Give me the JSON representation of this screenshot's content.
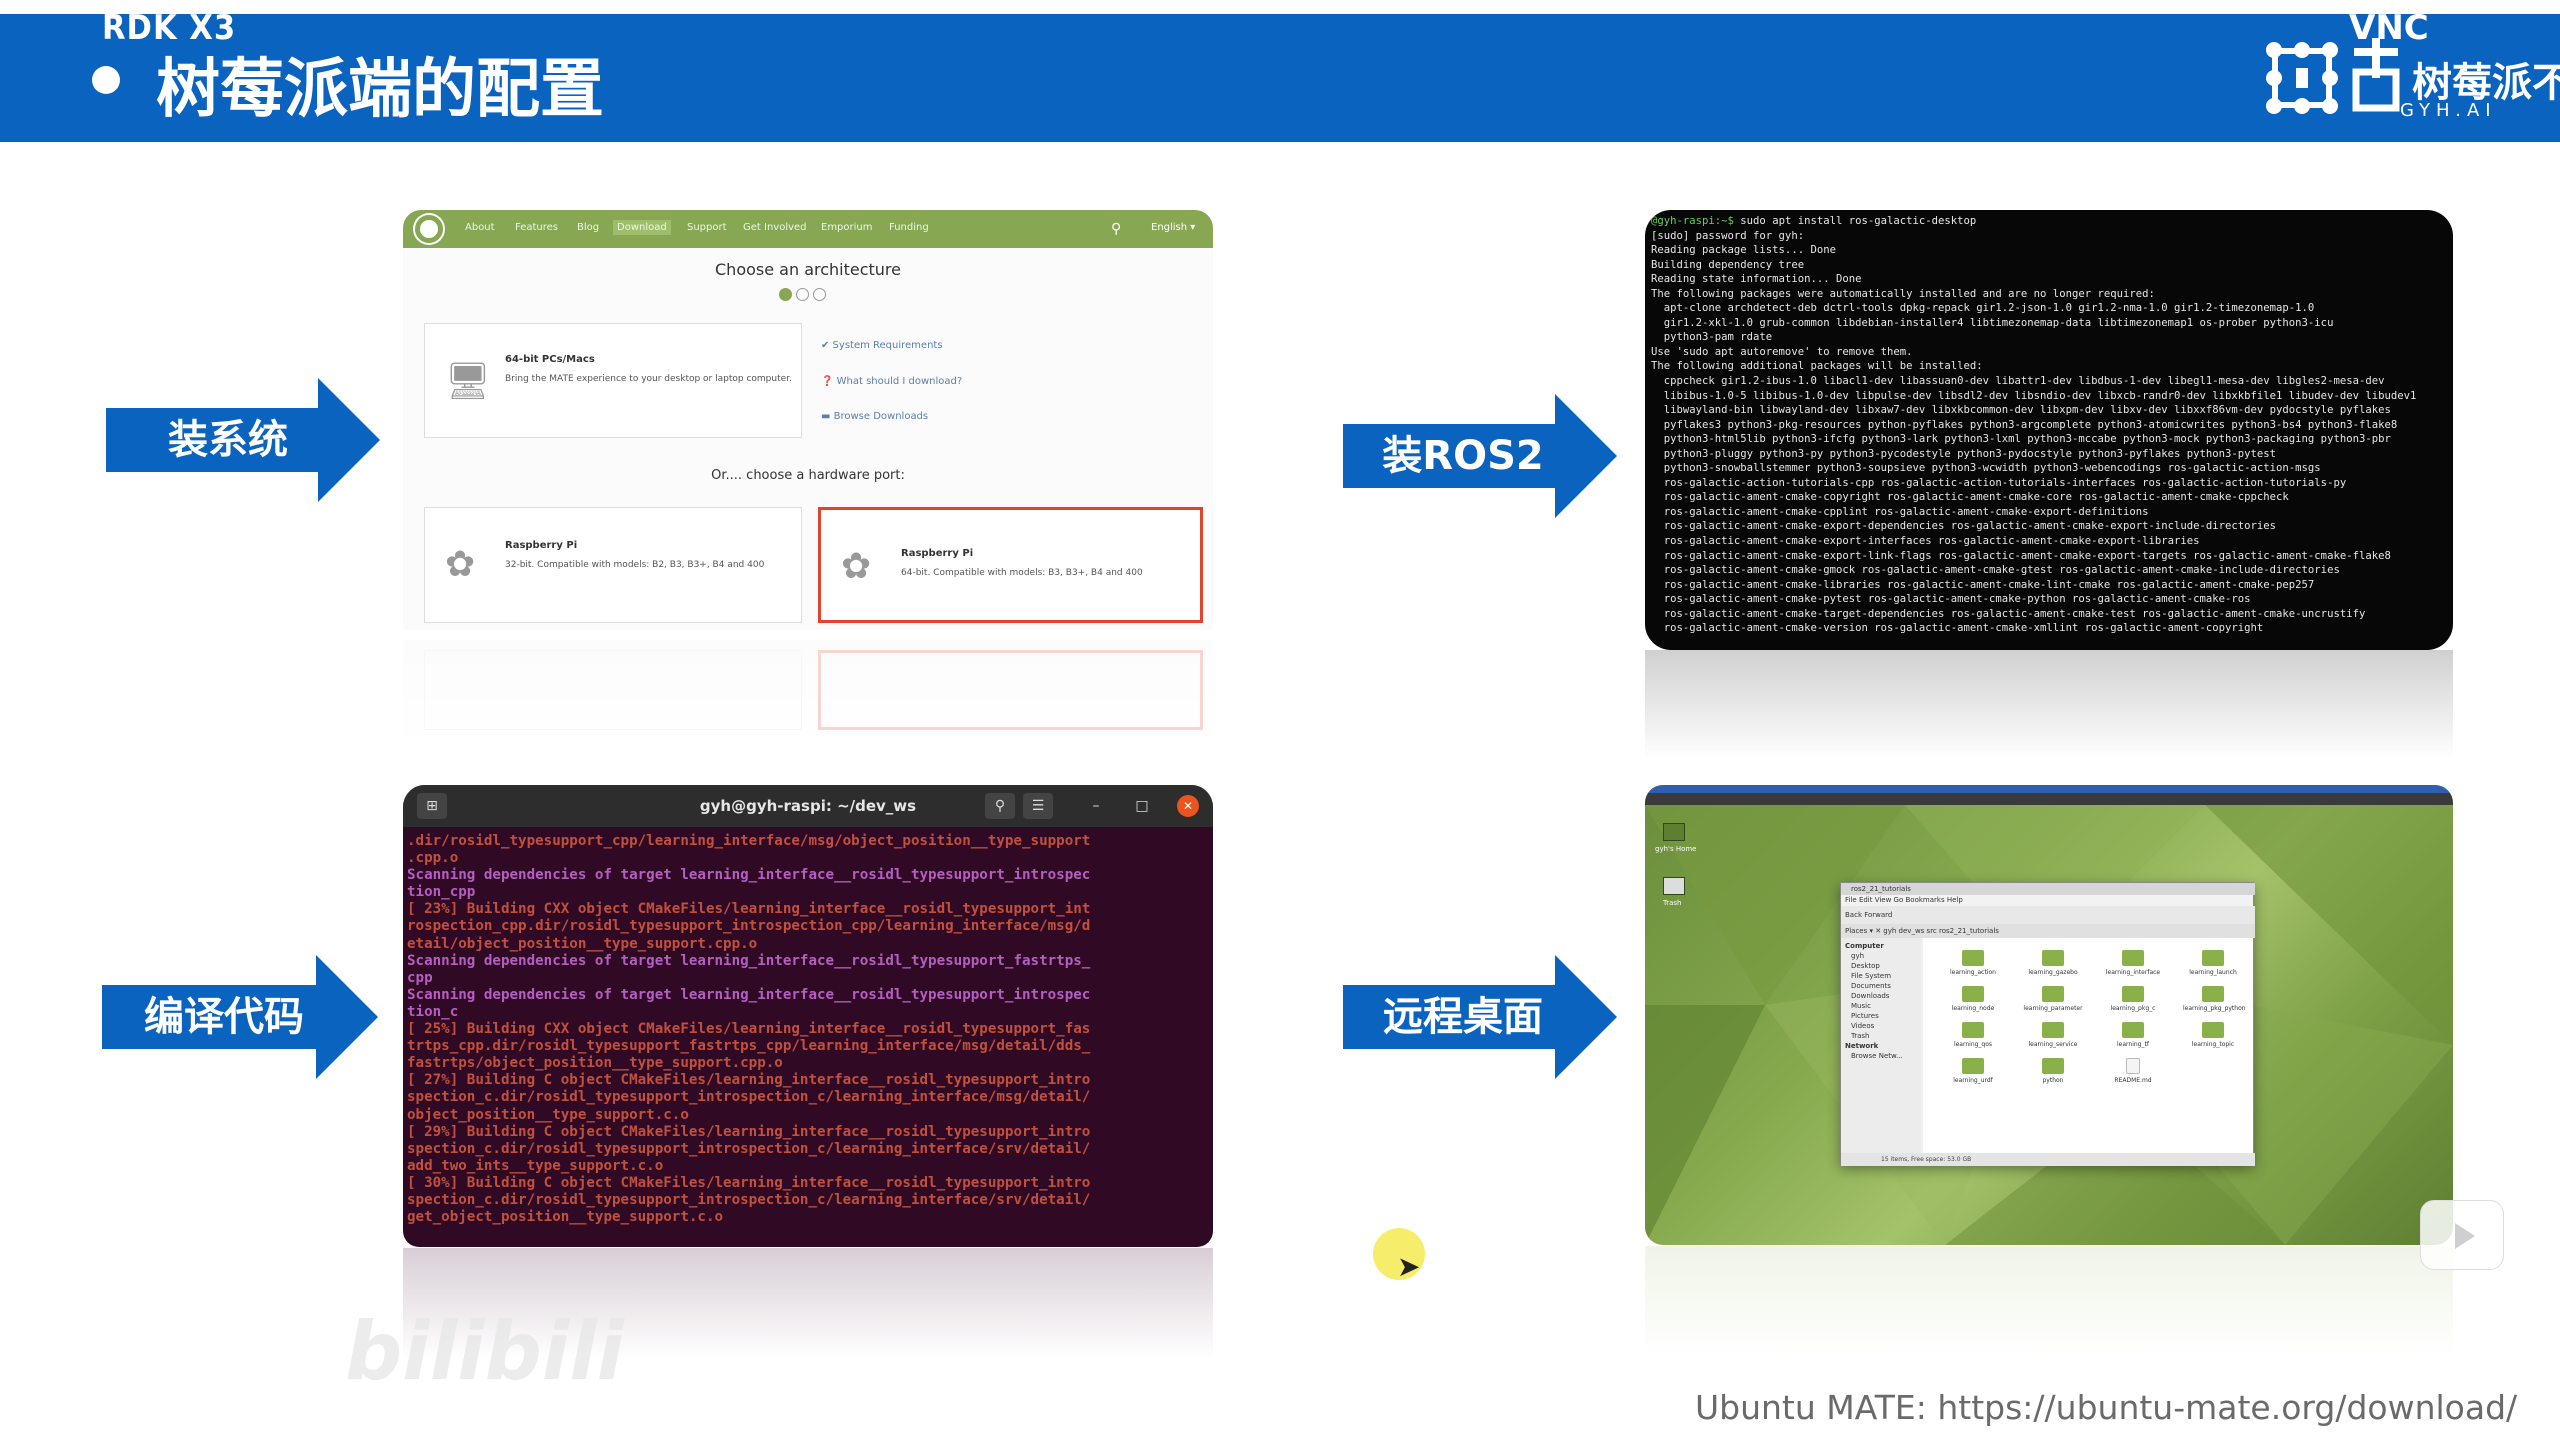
{
  "header": {
    "corner_left": "RDK  X3",
    "corner_right": "VNC",
    "title": "树莓派端的配置",
    "logo_text": "树莓派不",
    "logo_sub": "GYH.AI"
  },
  "arrows": {
    "install_system": "装系统",
    "install_ros2": "装ROS2",
    "compile_code": "编译代码",
    "remote_desktop": "远程桌面"
  },
  "mate_site": {
    "nav": [
      "About",
      "Features",
      "Blog",
      "Download",
      "Support",
      "Get Involved",
      "Emporium",
      "Funding"
    ],
    "lang": "English ▾",
    "heading": "Choose an architecture",
    "card_pc_title": "64-bit PCs/Macs",
    "card_pc_desc": "Bring the MATE experience to your desktop or laptop computer.",
    "link_sysreq": "✔ System Requirements",
    "link_which": "❓ What should I download?",
    "link_browse": "▬ Browse Downloads",
    "or_text": "Or.... choose a hardware port:",
    "card_pi32_title": "Raspberry Pi",
    "card_pi32_desc": "32-bit. Compatible with models: B2, B3, B3+, B4 and 400",
    "card_pi64_title": "Raspberry Pi",
    "card_pi64_desc": "64-bit. Compatible with models: B3, B3+, B4 and 400"
  },
  "ros_terminal": {
    "prompt": "@gyh-raspi:~$",
    "command": " sudo apt install ros-galactic-desktop",
    "lines": [
      "[sudo] password for gyh:",
      "Reading package lists... Done",
      "Building dependency tree",
      "Reading state information... Done",
      "The following packages were automatically installed and are no longer required:",
      "  apt-clone archdetect-deb dctrl-tools dpkg-repack gir1.2-json-1.0 gir1.2-nma-1.0 gir1.2-timezonemap-1.0",
      "  gir1.2-xkl-1.0 grub-common libdebian-installer4 libtimezonemap-data libtimezonemap1 os-prober python3-icu",
      "  python3-pam rdate",
      "Use 'sudo apt autoremove' to remove them.",
      "The following additional packages will be installed:",
      "  cppcheck gir1.2-ibus-1.0 libacl1-dev libassuan0-dev libattr1-dev libdbus-1-dev libegl1-mesa-dev libgles2-mesa-dev",
      "  libibus-1.0-5 libibus-1.0-dev libpulse-dev libsdl2-dev libsndio-dev libxcb-randr0-dev libxkbfile1 libudev-dev libudev1",
      "  libwayland-bin libwayland-dev libxaw7-dev libxkbcommon-dev libxpm-dev libxv-dev libxxf86vm-dev pydocstyle pyflakes",
      "  pyflakes3 python3-pkg-resources python-pyflakes python3-argcomplete python3-atomicwrites python3-bs4 python3-flake8",
      "  python3-html5lib python3-ifcfg python3-lark python3-lxml python3-mccabe python3-mock python3-packaging python3-pbr",
      "  python3-pluggy python3-py python3-pycodestyle python3-pydocstyle python3-pyflakes python3-pytest",
      "  python3-snowballstemmer python3-soupsieve python3-wcwidth python3-webencodings ros-galactic-action-msgs",
      "  ros-galactic-action-tutorials-cpp ros-galactic-action-tutorials-interfaces ros-galactic-action-tutorials-py",
      "  ros-galactic-ament-cmake-copyright ros-galactic-ament-cmake-core ros-galactic-ament-cmake-cppcheck",
      "  ros-galactic-ament-cmake-cpplint ros-galactic-ament-cmake-export-definitions",
      "  ros-galactic-ament-cmake-export-dependencies ros-galactic-ament-cmake-export-include-directories",
      "  ros-galactic-ament-cmake-export-interfaces ros-galactic-ament-cmake-export-libraries",
      "  ros-galactic-ament-cmake-export-link-flags ros-galactic-ament-cmake-export-targets ros-galactic-ament-cmake-flake8",
      "  ros-galactic-ament-cmake-gmock ros-galactic-ament-cmake-gtest ros-galactic-ament-cmake-include-directories",
      "  ros-galactic-ament-cmake-libraries ros-galactic-ament-cmake-lint-cmake ros-galactic-ament-cmake-pep257",
      "  ros-galactic-ament-cmake-pytest ros-galactic-ament-cmake-python ros-galactic-ament-cmake-ros",
      "  ros-galactic-ament-cmake-target-dependencies ros-galactic-ament-cmake-test ros-galactic-ament-cmake-uncrustify",
      "  ros-galactic-ament-cmake-version ros-galactic-ament-cmake-xmllint ros-galactic-ament-copyright"
    ]
  },
  "build_terminal": {
    "title": "gyh@gyh-raspi: ~/dev_ws",
    "lines": [
      {
        "c": "r",
        "t": ".dir/rosidl_typesupport_cpp/learning_interface/msg/object_position__type_support"
      },
      {
        "c": "r",
        "t": ".cpp.o"
      },
      {
        "c": "m",
        "t": "Scanning dependencies of target learning_interface__rosidl_typesupport_introspec"
      },
      {
        "c": "m",
        "t": "tion_cpp"
      },
      {
        "c": "r",
        "t": "[ 23%] Building CXX object CMakeFiles/learning_interface__rosidl_typesupport_int"
      },
      {
        "c": "r",
        "t": "rospection_cpp.dir/rosidl_typesupport_introspection_cpp/learning_interface/msg/d"
      },
      {
        "c": "r",
        "t": "etail/object_position__type_support.cpp.o"
      },
      {
        "c": "m",
        "t": "Scanning dependencies of target learning_interface__rosidl_typesupport_fastrtps_"
      },
      {
        "c": "m",
        "t": "cpp"
      },
      {
        "c": "m",
        "t": "Scanning dependencies of target learning_interface__rosidl_typesupport_introspec"
      },
      {
        "c": "m",
        "t": "tion_c"
      },
      {
        "c": "r",
        "t": "[ 25%] Building CXX object CMakeFiles/learning_interface__rosidl_typesupport_fas"
      },
      {
        "c": "r",
        "t": "trtps_cpp.dir/rosidl_typesupport_fastrtps_cpp/learning_interface/msg/detail/dds_"
      },
      {
        "c": "r",
        "t": "fastrtps/object_position__type_support.cpp.o"
      },
      {
        "c": "r",
        "t": "[ 27%] Building C object CMakeFiles/learning_interface__rosidl_typesupport_intro"
      },
      {
        "c": "r",
        "t": "spection_c.dir/rosidl_typesupport_introspection_c/learning_interface/msg/detail/"
      },
      {
        "c": "r",
        "t": "object_position__type_support.c.o"
      },
      {
        "c": "r",
        "t": "[ 29%] Building C object CMakeFiles/learning_interface__rosidl_typesupport_intro"
      },
      {
        "c": "r",
        "t": "spection_c.dir/rosidl_typesupport_introspection_c/learning_interface/srv/detail/"
      },
      {
        "c": "r",
        "t": "add_two_ints__type_support.c.o"
      },
      {
        "c": "r",
        "t": "[ 30%] Building C object CMakeFiles/learning_interface__rosidl_typesupport_intro"
      },
      {
        "c": "r",
        "t": "spection_c.dir/rosidl_typesupport_introspection_c/learning_interface/srv/detail/"
      },
      {
        "c": "r",
        "t": "get_object_position__type_support.c.o"
      }
    ]
  },
  "desktop": {
    "window_title": "ros2_21_tutorials",
    "menu": "File  Edit  View  Go  Bookmarks  Help",
    "toolbar": "Back   Forward",
    "location": "Places   ▾   ✕     gyh   dev_ws   src   ros2_21_tutorials",
    "sidebar": [
      "Computer",
      "gyh",
      "Desktop",
      "File System",
      "Documents",
      "Downloads",
      "Music",
      "Pictures",
      "Videos",
      "Trash",
      "Network",
      "Browse Netw..."
    ],
    "folders": [
      "learning_action",
      "learning_gazebo",
      "learning_interface",
      "learning_launch",
      "learning_node",
      "learning_parameter",
      "learning_pkg_c",
      "learning_pkg_python",
      "learning_qos",
      "learning_service",
      "learning_tf",
      "learning_topic",
      "learning_urdf",
      "python",
      "README.md"
    ],
    "status": "15 items, Free space: 53.0 GB",
    "desk_icons": [
      "gyh's Home",
      "Trash"
    ]
  },
  "footer": {
    "text": "Ubuntu MATE:  https://ubuntu-mate.org/download/"
  },
  "watermark": "bilibili"
}
